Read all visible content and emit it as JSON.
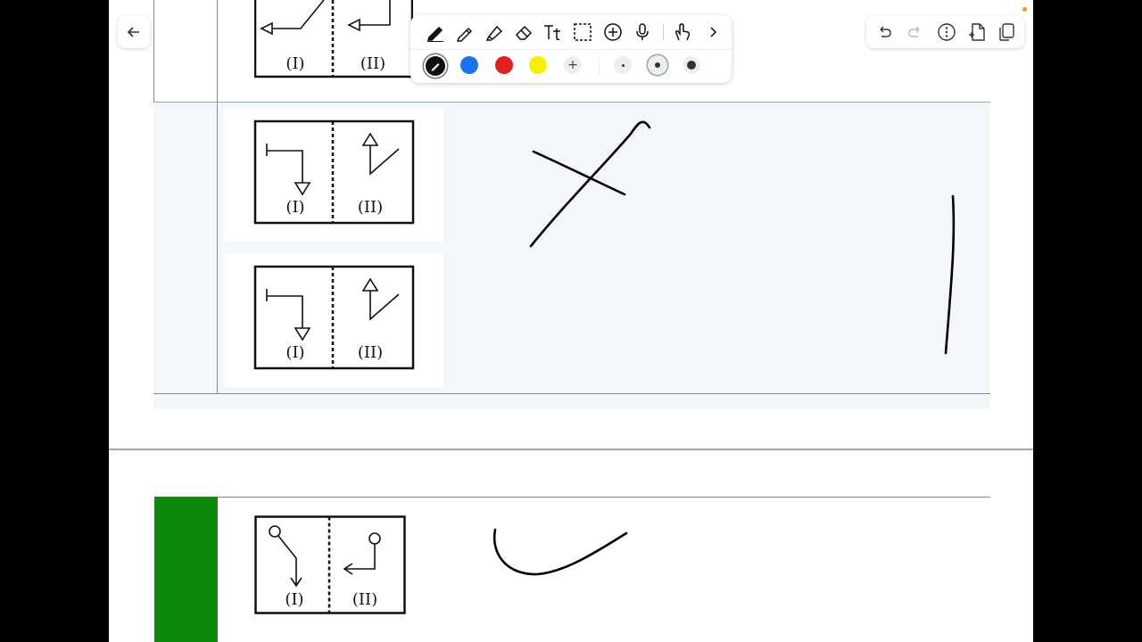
{
  "window": {
    "title": ""
  },
  "toolbar": {
    "tools": [
      "pen-icon",
      "pencil-icon",
      "highlighter-icon",
      "eraser-icon",
      "text-icon",
      "lasso-select-icon",
      "add-icon",
      "microphone-icon",
      "touch-draw-icon",
      "chevron-right-icon"
    ],
    "colors": [
      "#111111",
      "#1a73e8",
      "#e02020",
      "#f5f000"
    ],
    "add_color_label": "+",
    "stroke_sizes": [
      "thin",
      "medium",
      "thick"
    ]
  },
  "right_toolbar": {
    "tools": [
      "undo-icon",
      "redo-icon",
      "more-icon",
      "add-page-icon",
      "copy-icon"
    ]
  },
  "questions": [
    {
      "panel_labels": [
        "(I)",
        "(II)"
      ]
    },
    {
      "panel_labels": [
        "(I)",
        "(II)"
      ]
    },
    {
      "panel_labels": [
        "(I)",
        "(II)"
      ]
    },
    {
      "panel_labels": [
        "(I)",
        "(II)"
      ]
    }
  ],
  "accents": {
    "green": "#0b8a0b",
    "row_bg": "#f3f6fa"
  }
}
